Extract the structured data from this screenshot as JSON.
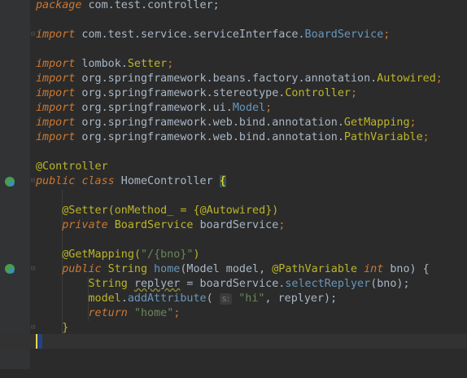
{
  "lines": [
    {
      "pkg_kw": "package",
      "pkg_name": " com.test.controller;"
    },
    {
      "kw": "import",
      "a": " com.test.service.serviceInterface.",
      "b": "BoardService",
      "c": ";"
    },
    {
      "kw": "import",
      "a": " lombok.",
      "b": "Setter",
      "c": ";"
    },
    {
      "kw": "import",
      "a": " org.springframework.beans.factory.annotation.",
      "b": "Autowired",
      "c": ";"
    },
    {
      "kw": "import",
      "a": " org.springframework.stereotype.",
      "b": "Controller",
      "c": ";"
    },
    {
      "kw": "import",
      "a": " org.springframework.ui.",
      "b": "Model",
      "c": ";"
    },
    {
      "kw": "import",
      "a": " org.springframework.web.bind.annotation.",
      "b": "GetMapping",
      "c": ";"
    },
    {
      "kw": "import",
      "a": " org.springframework.web.bind.annotation.",
      "b": "PathVariable",
      "c": ";"
    }
  ],
  "class_decl": {
    "annotation": "@Controller",
    "public": "public",
    "class": "class",
    "name": " HomeController ",
    "brace": "{"
  },
  "setter_line": {
    "ann": "@Setter",
    "open": "(",
    "arg": "onMethod_",
    "eq": " = {",
    "ann2": "@Autowired",
    "close": "})"
  },
  "field_line": {
    "private": "private",
    "type": " BoardService ",
    "name": "boardService",
    "semi": ";"
  },
  "getmapping_line": {
    "ann": "@GetMapping",
    "open": "(",
    "path": "\"/{bno}\"",
    "close": ")"
  },
  "method_line": {
    "public": "public",
    "ret": " String ",
    "name": "home",
    "p1": "(Model model, ",
    "ann": "@PathVariable",
    "int": "int",
    "p2": " bno) {"
  },
  "body_line1": {
    "type": "String ",
    "var": "replyer",
    "eq": " = boardService.",
    "call": "selectReplyer",
    "args": "(bno);"
  },
  "body_line2": {
    "obj": "model",
    "dot": ".",
    "call": "addAttribute",
    "open": "( ",
    "hint": "s:",
    "str": " \"hi\"",
    "rest": ", replyer);"
  },
  "body_line3": {
    "kw": "return",
    "str": " \"home\"",
    "semi": ";"
  },
  "method_close": "}",
  "colors": {
    "background": "#2b2b2b",
    "keyword": "#cc7832",
    "annotation": "#bbb529",
    "string": "#6a8759",
    "field": "#9876aa",
    "method": "#ffc66d"
  }
}
